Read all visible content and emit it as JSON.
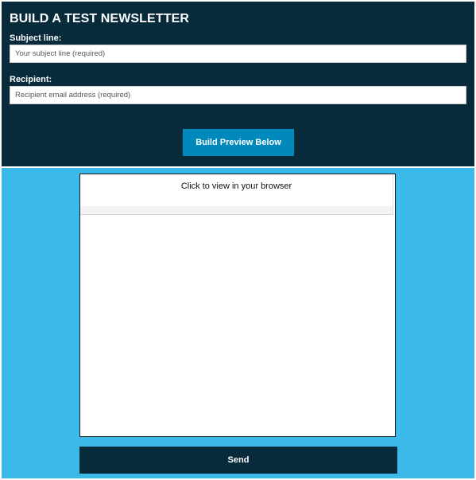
{
  "header": {
    "title": "BUILD A TEST NEWSLETTER"
  },
  "form": {
    "subject": {
      "label": "Subject line:",
      "placeholder": "Your subject line (required)",
      "value": ""
    },
    "recipient": {
      "label": "Recipient:",
      "placeholder": "Recipient email address (required)",
      "value": ""
    },
    "build_button_label": "Build Preview Below"
  },
  "preview": {
    "view_in_browser_text": "Click to view in your browser"
  },
  "actions": {
    "send_label": "Send"
  },
  "colors": {
    "dark_navy": "#072b3a",
    "sky_blue": "#3bb9e8",
    "button_blue": "#0089ba"
  }
}
